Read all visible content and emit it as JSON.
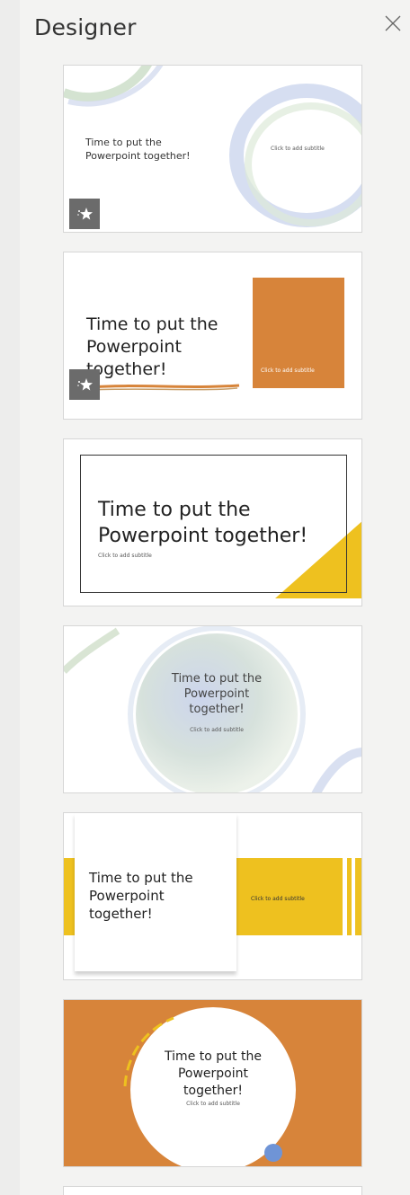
{
  "panel": {
    "title": "Designer",
    "close_label": "Close"
  },
  "designs": [
    {
      "title_line1": "Time to put the",
      "title_line2": "Powerpoint together!",
      "subtitle": "Click to add subtitle"
    },
    {
      "title_line1": "Time to put the",
      "title_line2": "Powerpoint",
      "title_line3": "together!",
      "subtitle": "Click to add subtitle"
    },
    {
      "title_line1": "Time to put the",
      "title_line2": "Powerpoint together!",
      "subtitle": "Click to add subtitle"
    },
    {
      "title_line1": "Time to put the",
      "title_line2": "Powerpoint",
      "title_line3": "together!",
      "subtitle": "Click to add subtitle"
    },
    {
      "title_line1": "Time to put the",
      "title_line2": "Powerpoint",
      "title_line3": "together!",
      "subtitle": "Click to add subtitle"
    },
    {
      "title_line1": "Time to put the",
      "title_line2": "Powerpoint",
      "title_line3": "together!",
      "subtitle": "Click to add subtitle"
    }
  ],
  "colors": {
    "orange": "#d7843a",
    "yellow": "#eec11f",
    "badge": "#6b6b6b",
    "accent_blue": "#6f94d6"
  },
  "icons": {
    "close": "close-icon",
    "designer_badge": "sparkle-star-icon"
  }
}
